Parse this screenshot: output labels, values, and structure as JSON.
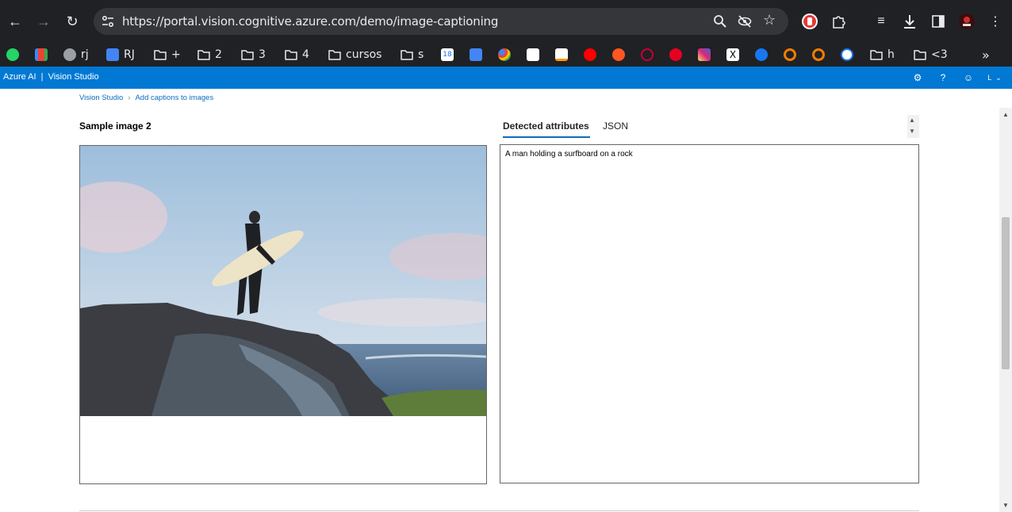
{
  "browser": {
    "url": "https://portal.vision.cognitive.azure.com/demo/image-captioning",
    "bookmarks": [
      {
        "label": "",
        "icon": "whatsapp-icon"
      },
      {
        "label": "",
        "icon": "gmail-icon"
      },
      {
        "label": "rj",
        "icon": "globe-icon"
      },
      {
        "label": "RJ",
        "icon": "app-icon"
      },
      {
        "label": "+",
        "icon": "folder-icon"
      },
      {
        "label": "2",
        "icon": "folder-icon"
      },
      {
        "label": "3",
        "icon": "folder-icon"
      },
      {
        "label": "4",
        "icon": "folder-icon"
      },
      {
        "label": "cursos",
        "icon": "folder-icon"
      },
      {
        "label": "s",
        "icon": "folder-icon"
      },
      {
        "label": "h",
        "icon": "folder-icon"
      },
      {
        "label": "<3",
        "icon": "folder-icon"
      }
    ],
    "calendar_badge": "18"
  },
  "azure": {
    "brand": "Azure AI",
    "separator": "|",
    "product": "Vision Studio",
    "user_initial": "L"
  },
  "breadcrumb": {
    "home": "Vision Studio",
    "separator": "›",
    "current": "Add captions to images"
  },
  "main": {
    "sample_title": "Sample image 2",
    "tabs": [
      {
        "label": "Detected attributes",
        "active": true
      },
      {
        "label": "JSON",
        "active": false
      }
    ],
    "caption": "A man holding a surfboard on a rock"
  }
}
